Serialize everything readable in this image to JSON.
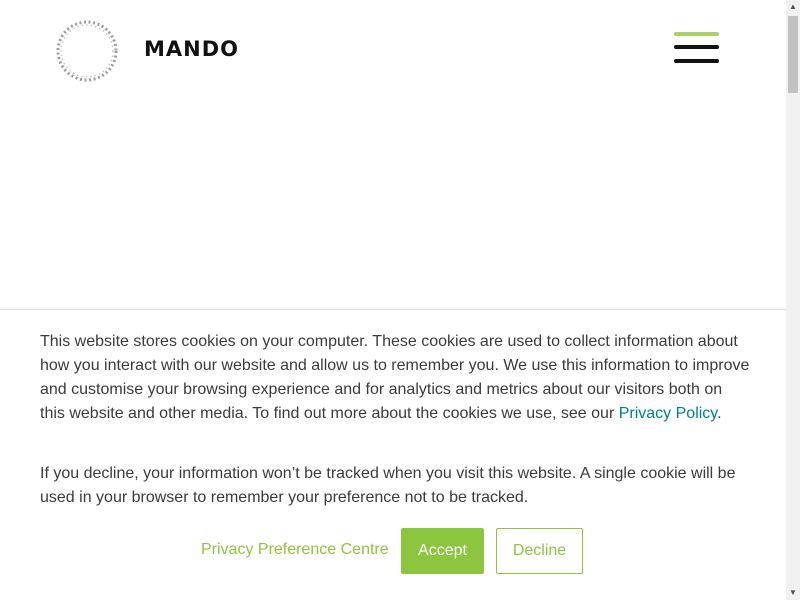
{
  "header": {
    "brand": "MANDO",
    "logo_icon": "circle-rope-logo-icon",
    "menu_icon": "hamburger-menu-icon",
    "menu_bar_colors": [
      "#a9cf6b",
      "#111111",
      "#111111"
    ]
  },
  "cookie_banner": {
    "paragraph1_text": "This website stores cookies on your computer. These cookies are used to collect information about how you interact with our website and allow us to remember you. We use this information to improve and customise your browsing experience and for analytics and metrics about our visitors both on this website and other media. To find out more about the cookies we use, see our ",
    "privacy_link": "Privacy Policy",
    "paragraph1_end": ".",
    "paragraph2_text": "If you decline, your information won’t be tracked when you visit this website. A single cookie will be used in your browser to remember your preference not to be tracked.",
    "preference_link": "Privacy Preference Centre",
    "accept_label": "Accept",
    "decline_label": "Decline"
  },
  "colors": {
    "accent_green": "#8cc63e",
    "link_teal": "#00808c",
    "text": "#3b3b3b"
  },
  "scrollbar": {
    "up_arrow": "▲",
    "down_arrow": "▼"
  }
}
